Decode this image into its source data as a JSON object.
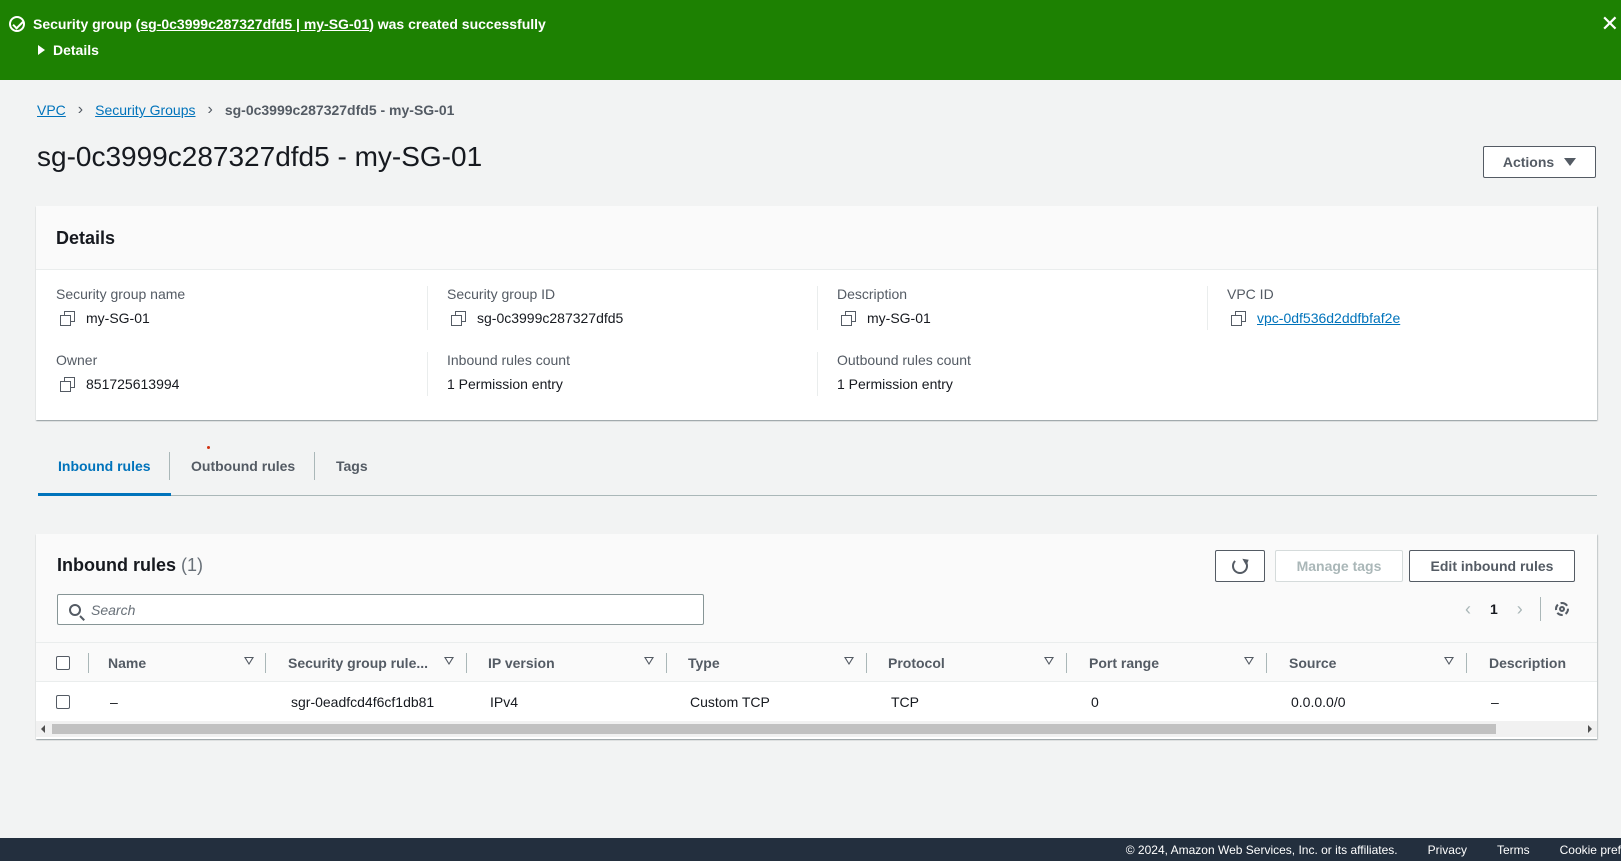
{
  "flash": {
    "message_prefix": "Security group (",
    "message_link": "sg-0c3999c287327dfd5 | my-SG-01",
    "message_suffix": ") was created successfully",
    "details_label": "Details",
    "color": "#1d8102"
  },
  "breadcrumb": {
    "items": [
      "VPC",
      "Security Groups"
    ],
    "current": "sg-0c3999c287327dfd5 - my-SG-01"
  },
  "page_title": "sg-0c3999c287327dfd5 - my-SG-01",
  "actions_label": "Actions",
  "details": {
    "title": "Details",
    "fields": [
      {
        "label": "Security group name",
        "value": "my-SG-01"
      },
      {
        "label": "Security group ID",
        "value": "sg-0c3999c287327dfd5"
      },
      {
        "label": "Description",
        "value": "my-SG-01"
      },
      {
        "label": "VPC ID",
        "value": "vpc-0df536d2ddfbfaf2e"
      },
      {
        "label": "Owner",
        "value": "851725613994"
      },
      {
        "label": "Inbound rules count",
        "value": "1 Permission entry"
      },
      {
        "label": "Outbound rules count",
        "value": "1 Permission entry"
      }
    ]
  },
  "tabs": [
    "Inbound rules",
    "Outbound rules",
    "Tags"
  ],
  "rules": {
    "title": "Inbound rules",
    "count": "(1)",
    "manage_tags_label": "Manage tags",
    "edit_label": "Edit inbound rules",
    "search_placeholder": "Search",
    "page": "1",
    "columns": [
      "Name",
      "Security group rule...",
      "IP version",
      "Type",
      "Protocol",
      "Port range",
      "Source",
      "Description"
    ],
    "rows": [
      [
        "–",
        "sgr-0eadfcd4f6cf1db81",
        "IPv4",
        "Custom TCP",
        "TCP",
        "0",
        "0.0.0.0/0",
        "–"
      ]
    ]
  },
  "footer": {
    "copyright": "© 2024, Amazon Web Services, Inc. or its affiliates.",
    "links": [
      "Privacy",
      "Terms",
      "Cookie pref"
    ]
  },
  "colors": {
    "link": "#0073bb",
    "footer_bg": "#232f3e"
  }
}
